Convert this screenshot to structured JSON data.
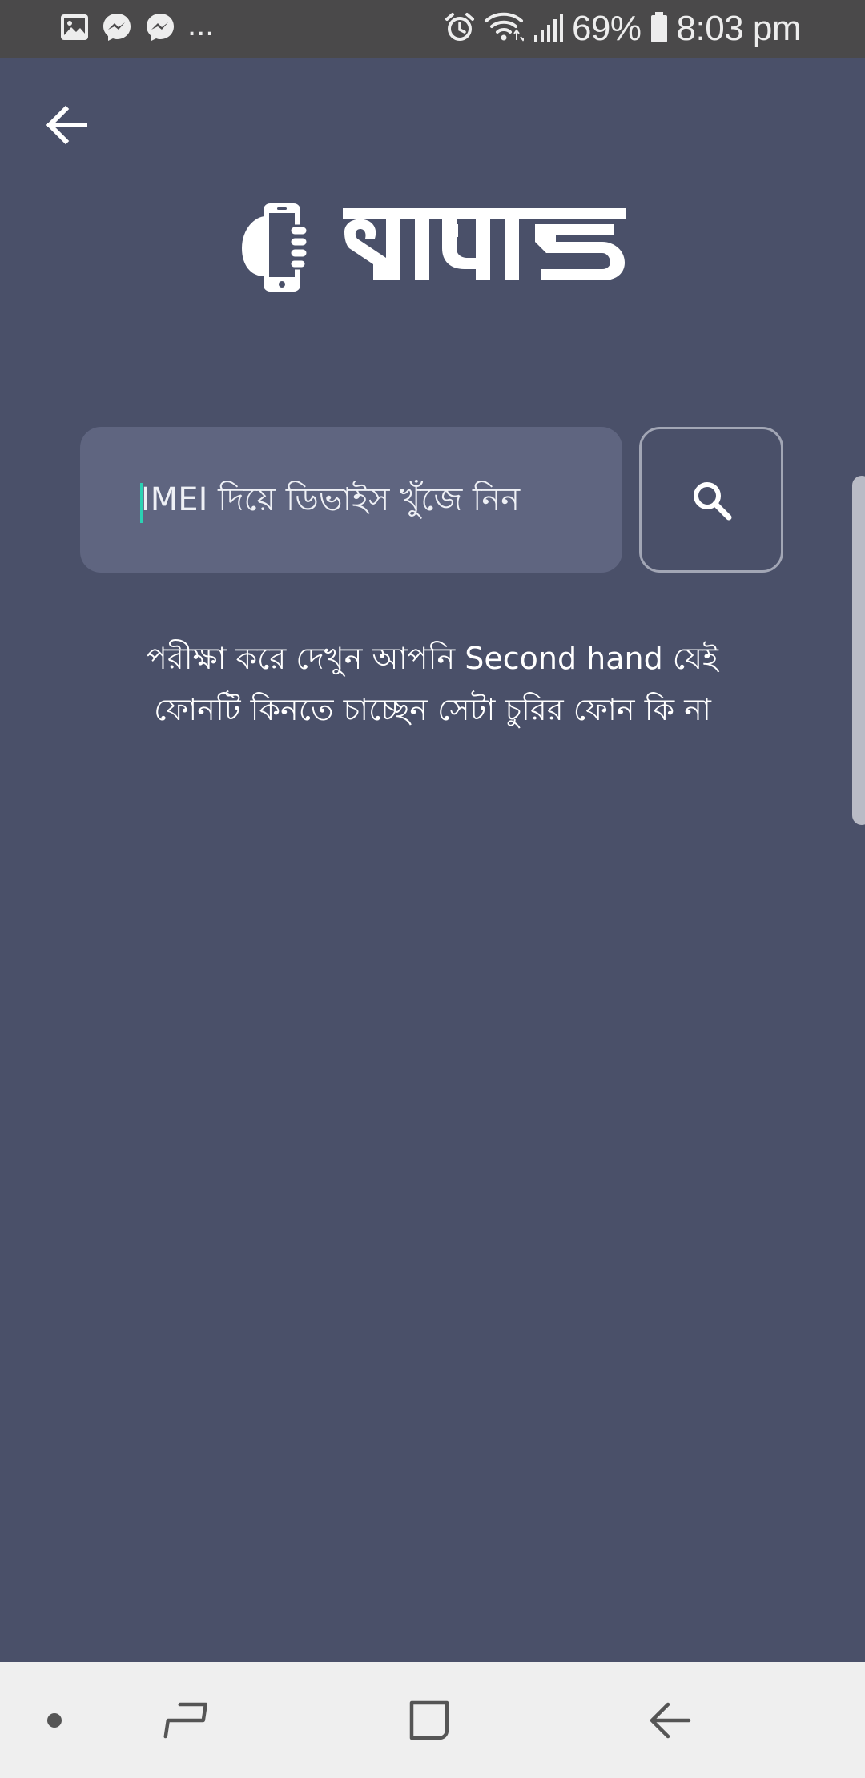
{
  "status_bar": {
    "left_icons": [
      "image-icon",
      "messenger-icon",
      "messenger-icon"
    ],
    "overflow": "...",
    "right_icons": [
      "alarm-icon",
      "wifi-icon",
      "signal-icon",
      "battery-icon"
    ],
    "battery": "69%",
    "time": "8:03 pm"
  },
  "header": {
    "back_icon": "arrow-left-icon",
    "logo_text": "থামাও",
    "logo_icon": "hand-phone-icon"
  },
  "search": {
    "placeholder": "IMEI দিয়ে ডিভাইস খুঁজে নিন",
    "value": "",
    "button_icon": "search-icon"
  },
  "description": {
    "line1": "পরীক্ষা করে দেখুন আপনি Second hand যেই",
    "line2": "ফোনটি কিনতে চাচ্ছেন সেটা চুরির ফোন কি না"
  },
  "nav_bar": {
    "items": [
      "dot-icon",
      "recent-apps-icon",
      "home-icon",
      "back-icon"
    ]
  },
  "colors": {
    "background": "#4a5069",
    "status_bar": "#4a494a",
    "field": "#5f6580",
    "cursor": "#2bd2b3",
    "nav_bar": "#efefef"
  }
}
